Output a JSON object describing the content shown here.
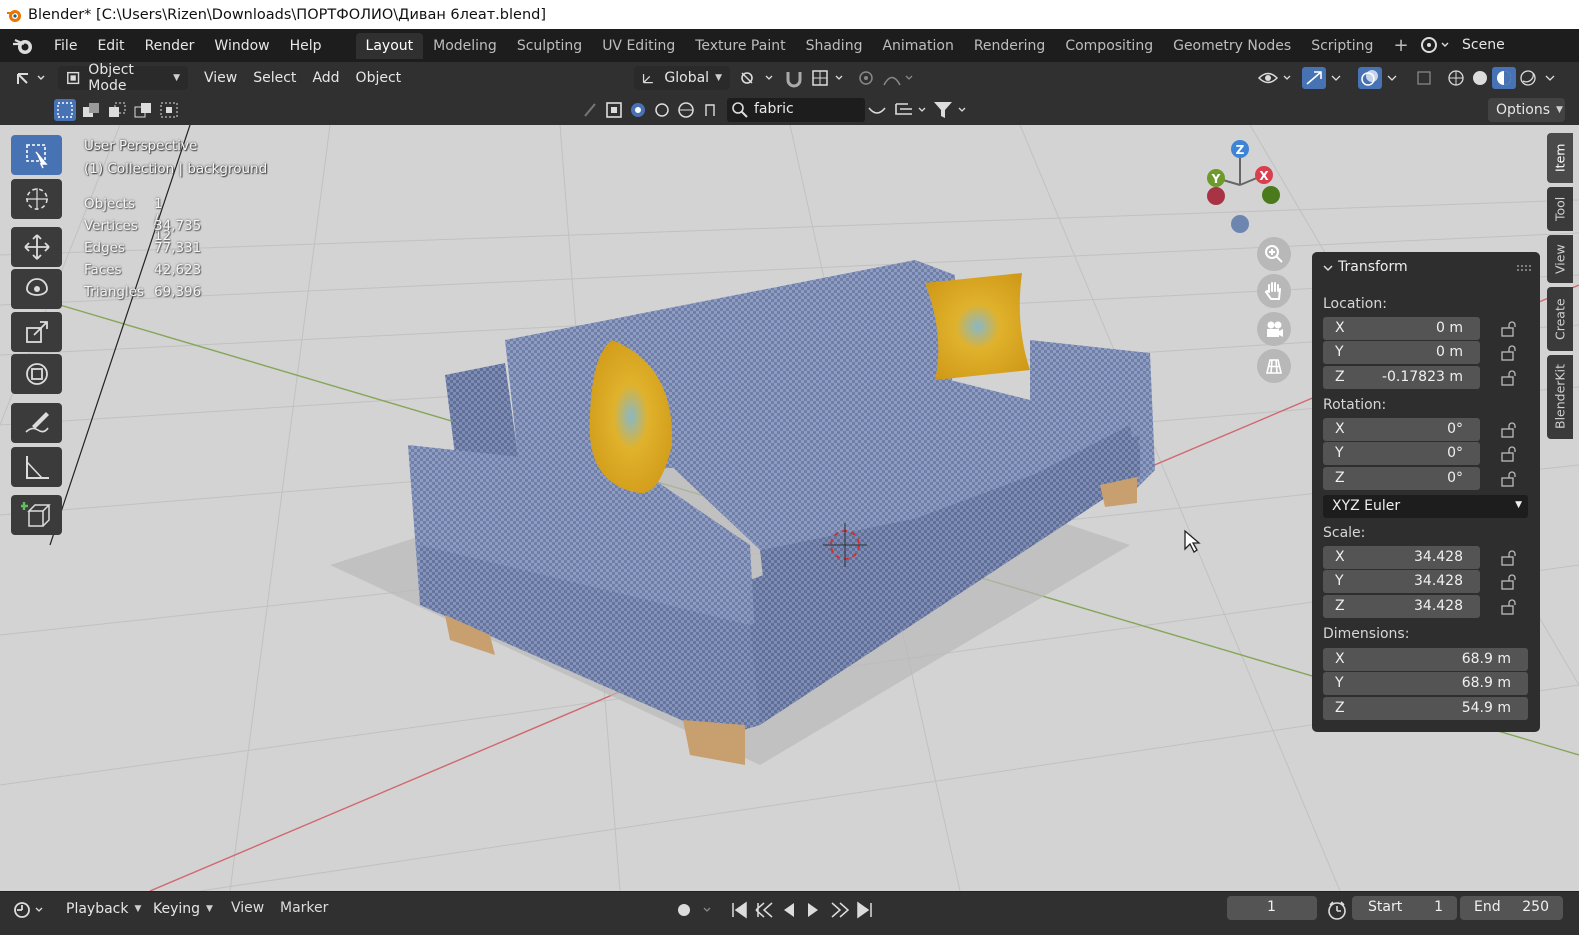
{
  "window": {
    "title": "Blender* [C:\\Users\\Rizen\\Downloads\\ПОРТФОЛИО\\Диван 6леат.blend]"
  },
  "menu": [
    "File",
    "Edit",
    "Render",
    "Window",
    "Help"
  ],
  "workspaces": [
    "Layout",
    "Modeling",
    "Sculpting",
    "UV Editing",
    "Texture Paint",
    "Shading",
    "Animation",
    "Rendering",
    "Compositing",
    "Geometry Nodes",
    "Scripting"
  ],
  "active_workspace": "Layout",
  "scene": {
    "label": "Scene"
  },
  "header": {
    "mode": "Object Mode",
    "view": "View",
    "select": "Select",
    "add": "Add",
    "object": "Object",
    "orientation": "Global"
  },
  "tool_header": {
    "search_value": "fabric",
    "options": "Options"
  },
  "viewport": {
    "perspective": "User Perspective",
    "collection": "(1) Collection | background",
    "stats": [
      {
        "label": "Objects",
        "value": "1 / 12"
      },
      {
        "label": "Vertices",
        "value": "34,735"
      },
      {
        "label": "Edges",
        "value": "77,331"
      },
      {
        "label": "Faces",
        "value": "42,623"
      },
      {
        "label": "Triangles",
        "value": "69,396"
      }
    ],
    "gizmo": {
      "x": "X",
      "y": "Y",
      "z": "Z"
    }
  },
  "npanel": {
    "title": "Transform",
    "location_label": "Location:",
    "location": [
      {
        "axis": "X",
        "value": "0 m"
      },
      {
        "axis": "Y",
        "value": "0 m"
      },
      {
        "axis": "Z",
        "value": "-0.17823 m"
      }
    ],
    "rotation_label": "Rotation:",
    "rotation": [
      {
        "axis": "X",
        "value": "0°"
      },
      {
        "axis": "Y",
        "value": "0°"
      },
      {
        "axis": "Z",
        "value": "0°"
      }
    ],
    "rotation_mode": "XYZ Euler",
    "scale_label": "Scale:",
    "scale": [
      {
        "axis": "X",
        "value": "34.428"
      },
      {
        "axis": "Y",
        "value": "34.428"
      },
      {
        "axis": "Z",
        "value": "34.428"
      }
    ],
    "dimensions_label": "Dimensions:",
    "dimensions": [
      {
        "axis": "X",
        "value": "68.9 m"
      },
      {
        "axis": "Y",
        "value": "68.9 m"
      },
      {
        "axis": "Z",
        "value": "54.9 m"
      }
    ],
    "tabs": [
      "Item",
      "Tool",
      "View",
      "Create",
      "BlenderKit"
    ]
  },
  "timeline": {
    "playback": "Playback",
    "keying": "Keying",
    "view": "View",
    "marker": "Marker",
    "current_frame": "1",
    "start_label": "Start",
    "start": "1",
    "end_label": "End",
    "end": "250"
  },
  "colors": {
    "accent": "#4772b3",
    "x_axis": "#d8404f",
    "y_axis": "#6e9a2b",
    "z_axis": "#3d83d6"
  }
}
